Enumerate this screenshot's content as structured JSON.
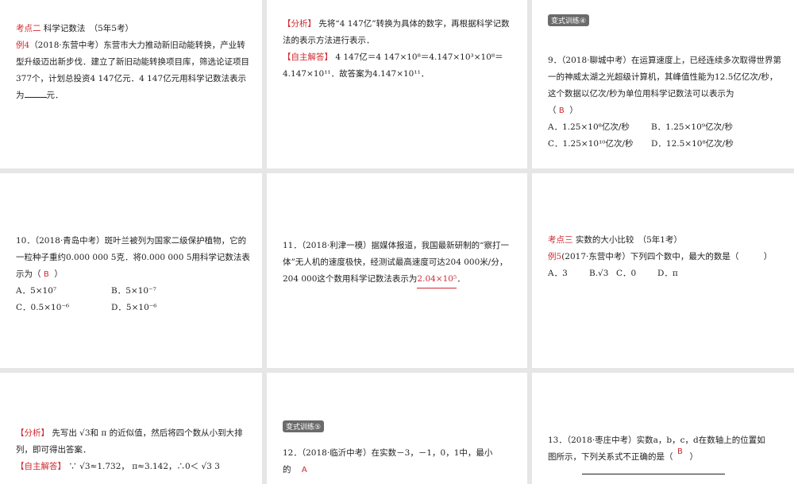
{
  "s1": {
    "heading_red": "考点二",
    "heading": " 科学记数法　（5年5考）",
    "ex_label": "例4",
    "ex_text": "（2018·东营中考）东营市大力推动新旧动能转换，产业转型升级迈出新步伐．建立了新旧动能转换项目库，筛选论证项目377个，计划总投资4 147亿元．4 147亿元用科学记数法表示为",
    "ex_tail": "元．"
  },
  "s2": {
    "analysis_label": "【分析】",
    "analysis": " 先将“4 147亿”转换为具体的数字，再根据科学记数法的表示方法进行表示．",
    "answer_label": "【自主解答】",
    "answer": " 4 147亿＝4 147×10⁸＝4.147×10³×10⁸＝4.147×10¹¹．故答案为4.147×10¹¹．"
  },
  "s3": {
    "badge": "变式训练④",
    "q": "9．（2018·聊城中考）在运算速度上，已经连续多次取得世界第一的神威太湖之光超级计算机，其峰值性能为12.5亿亿次/秒，这个数据以亿次/秒为单位用科学记数法可以表示为",
    "paren_open": "（",
    "answer": "B",
    "paren_close": "）",
    "options": [
      "A．1.25×10⁸亿次/秒",
      "B．1.25×10⁹亿次/秒",
      "C．1.25×10¹⁰亿次/秒",
      "D．12.5×10⁸亿次/秒"
    ]
  },
  "s4": {
    "q": "10．（2018·青岛中考）斑叶兰被列为国家二级保护植物，它的一粒种子重约0.000 000 5克．将0.000 000 5用科学记数法表示为（",
    "answer": "B",
    "paren_close": "）",
    "options": [
      "A．5×10⁷",
      "B．5×10⁻⁷",
      "C．0.5×10⁻⁶",
      "D．5×10⁻⁶"
    ]
  },
  "s5": {
    "q": "11．（2018·利津一模）据媒体报道，我国最新研制的“察打一体”无人机的速度极快，经测试最高速度可达204 000米/分，204 000这个数用科学记数法表示为",
    "answer": "2.04×10⁵",
    "tail": "．"
  },
  "s6": {
    "heading_red": "考点三",
    "heading": " 实数的大小比较　（5年1考）",
    "ex_label": "例5",
    "ex_text": "(2017·东营中考）下列四个数中，最大的数是（　　　）",
    "options": [
      "A．3",
      "B.√3",
      "C．0",
      "D．π"
    ]
  },
  "s7": {
    "analysis_label": "【分析】",
    "analysis": " 先写出 √3和 π 的近似值，然后将四个数从小到大排列，即可得出答案．",
    "answer_label": "【自主解答】",
    "answer": " ∵ √3≈1.732， π≈3.142，∴0＜ √3 3"
  },
  "s8": {
    "badge": "变式训练⑤",
    "q": "12．（2018·临沂中考）在实数－3，－1，0，1中，最小的",
    "answer": "A"
  },
  "s9": {
    "q1": "13．（2018·枣庄中考）实数a，b，c，d在数轴上的位置如",
    "answer": "B",
    "q2": "图所示，下列关系式不正确的是（　　）"
  }
}
